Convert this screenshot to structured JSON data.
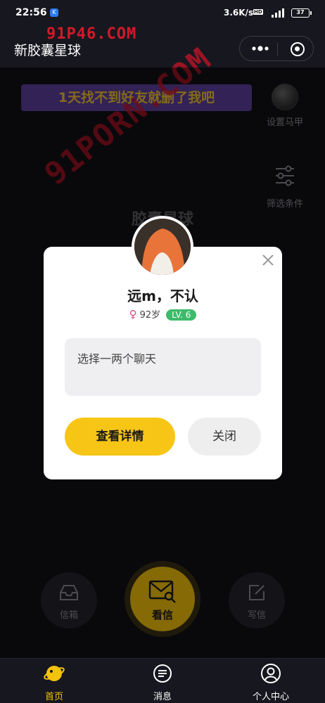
{
  "status_bar": {
    "time": "22:56",
    "network_speed": "3.6K/s",
    "hd_badge": "HD",
    "battery": "37",
    "app_badge": "K"
  },
  "header": {
    "title": "新胶囊星球",
    "watermark": "91P46.COM"
  },
  "banner": {
    "text": "1天找不到好友就删了我吧"
  },
  "side_actions": {
    "set_vest": "设置马甲",
    "filter": "筛选条件"
  },
  "planet_title": "胶囊星球",
  "diag_watermark": "91PORN.COM",
  "actions": {
    "inbox": "信箱",
    "read": "看信",
    "write": "写信"
  },
  "modal": {
    "name": "远m，不认",
    "gender_symbol": "♀",
    "age": "92岁",
    "level": "LV. 6",
    "message": "选择一两个聊天",
    "detail_button": "查看详情",
    "close_button": "关闭"
  },
  "tabbar": {
    "home": "首页",
    "messages": "消息",
    "profile": "个人中心"
  },
  "colors": {
    "accent": "#f3c20b",
    "level_badge": "#3dbb6a",
    "banner_bg": "#5b3f9c",
    "banner_text": "#f0c232",
    "female": "#e0457b"
  }
}
